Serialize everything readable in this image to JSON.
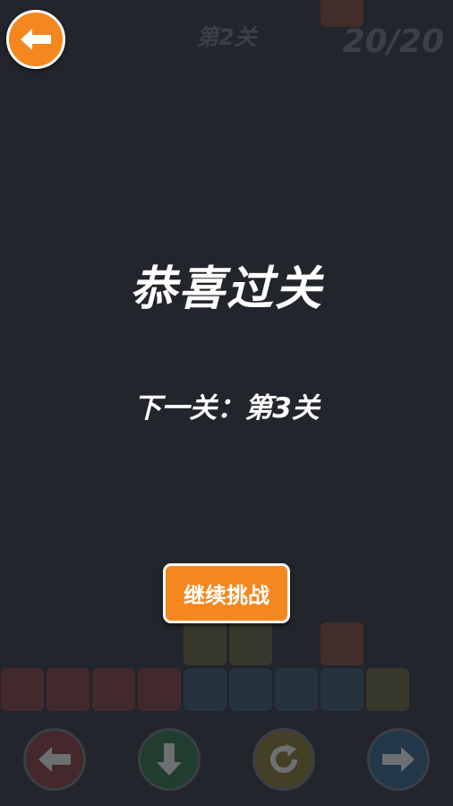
{
  "header": {
    "back_icon": "arrow-left-icon",
    "level_label": "第2关",
    "counter": "20/20"
  },
  "board": {
    "blocks": [
      {
        "col": 7,
        "row": 0,
        "color": "brown"
      },
      {
        "col": 4,
        "row": 14,
        "color": "olive"
      },
      {
        "col": 5,
        "row": 14,
        "color": "olive"
      },
      {
        "col": 7,
        "row": 14,
        "color": "brown"
      },
      {
        "col": 0,
        "row": 15,
        "color": "red"
      },
      {
        "col": 1,
        "row": 15,
        "color": "red"
      },
      {
        "col": 2,
        "row": 15,
        "color": "red"
      },
      {
        "col": 3,
        "row": 15,
        "color": "red"
      },
      {
        "col": 4,
        "row": 15,
        "color": "blue"
      },
      {
        "col": 5,
        "row": 15,
        "color": "blue"
      },
      {
        "col": 6,
        "row": 15,
        "color": "blue"
      },
      {
        "col": 7,
        "row": 15,
        "color": "blue"
      },
      {
        "col": 8,
        "row": 15,
        "color": "olive"
      }
    ]
  },
  "controls": {
    "left_icon": "arrow-left-icon",
    "down_icon": "arrow-down-icon",
    "rotate_icon": "rotate-icon",
    "right_icon": "arrow-right-icon"
  },
  "overlay": {
    "title": "恭喜过关",
    "next_level": "下一关：第3关",
    "continue_label": "继续挑战"
  },
  "colors": {
    "background": "#22252b",
    "accent": "#f5871f"
  }
}
